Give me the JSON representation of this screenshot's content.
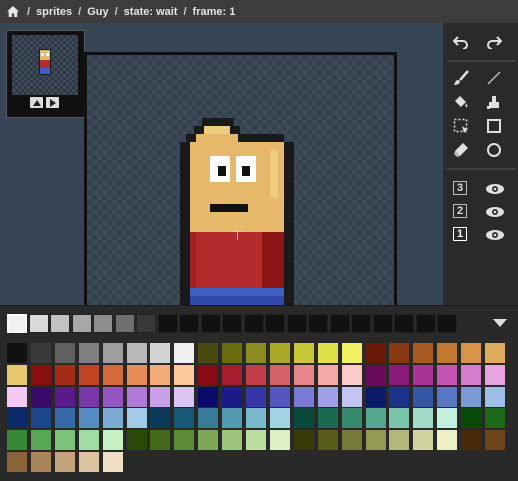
{
  "breadcrumb": {
    "home_icon": "home-icon",
    "items": [
      "sprites",
      "Guy",
      "state: wait",
      "frame: 1"
    ],
    "separator": "/"
  },
  "colors": {
    "topbar": "#3c3c3c",
    "canvas_bg": "#364657",
    "toolbar_bg": "#2a2a2a",
    "palette_bg": "#292929",
    "icon": "#e0e0e0"
  },
  "thumbnail": {
    "prev_icon": "caret-up-icon",
    "play_icon": "play-icon"
  },
  "tools": {
    "undo_icon": "undo-icon",
    "redo_icon": "redo-icon",
    "brush_icon": "brush-icon",
    "line_icon": "line-icon",
    "fill_icon": "paint-bucket-icon",
    "replace_icon": "color-replace-icon",
    "select_icon": "selection-icon",
    "rect_icon": "rectangle-icon",
    "eraser_icon": "eraser-icon",
    "circle_icon": "circle-icon"
  },
  "layers": [
    {
      "label": "3",
      "visible": true,
      "active": false
    },
    {
      "label": "2",
      "visible": true,
      "active": false
    },
    {
      "label": "1",
      "visible": true,
      "active": true
    }
  ],
  "sprite_colors": {
    "outline": "#1a1a1a",
    "skin": "#e6b86a",
    "skin_light": "#f0cc80",
    "eye_white": "#ffffff",
    "pupil": "#111111",
    "mouth": "#111111",
    "shirt": "#b52a2a",
    "shirt_dark": "#8f1616",
    "pants": "#3f5fc4"
  },
  "recent_colors": [
    "#f0f0f0",
    "#d9d9d9",
    "#c2c2c2",
    "#a8a8a8",
    "#8e8e8e",
    "#6f6f6f",
    "#3a3a3a",
    "#111111",
    "#111111",
    "#111111",
    "#111111",
    "#111111",
    "#111111",
    "#111111",
    "#111111",
    "#111111",
    "#111111",
    "#111111",
    "#111111",
    "#111111",
    "#111111"
  ],
  "palette_colors": [
    "#111111",
    "#3a3a3a",
    "#606060",
    "#7f7f7f",
    "#9e9e9e",
    "#b8b8b8",
    "#d4d4d4",
    "#efefef",
    "#4a4a0e",
    "#6c6c10",
    "#8b8b1e",
    "#aaaa28",
    "#c6c636",
    "#e0e048",
    "#f0f060",
    "#6b1a08",
    "#8a3812",
    "#a85a20",
    "#c2782e",
    "#d69444",
    "#e0ac5c",
    "#e8c86e",
    "#8a1010",
    "#a62a14",
    "#c24424",
    "#d66a3a",
    "#e88c56",
    "#f4ac78",
    "#fcc898",
    "#8a0a14",
    "#a81e30",
    "#c23c4a",
    "#d6606a",
    "#e8848a",
    "#f4a8aa",
    "#fccac8",
    "#6a0a5a",
    "#8a1a78",
    "#a83496",
    "#c256b2",
    "#d67ccc",
    "#e8a4e0",
    "#f4c8f0",
    "#3a0a6a",
    "#5a1a8a",
    "#7836a8",
    "#9656c2",
    "#b07ad6",
    "#c8a0e8",
    "#dcc4f4",
    "#0a0a6a",
    "#1a1a8a",
    "#3636a8",
    "#5656c2",
    "#7a7ad6",
    "#a0a0e8",
    "#c4c4f4",
    "#0a1a6a",
    "#1a348a",
    "#3656a8",
    "#5678c2",
    "#7a9ad6",
    "#a0bce8",
    "#0a2a6a",
    "#1a488a",
    "#366aa8",
    "#568cc2",
    "#7aacd6",
    "#a0cce8",
    "#0a3a5a",
    "#1a5878",
    "#367a96",
    "#569ab2",
    "#7ab8cc",
    "#a0d4e4",
    "#0a4a3a",
    "#1a6a52",
    "#368a6e",
    "#56a88c",
    "#7ac4aa",
    "#a0dcc6",
    "#c4f0e0",
    "#0a4a0a",
    "#1a6a1a",
    "#368a36",
    "#56a856",
    "#7ac47a",
    "#a0dca0",
    "#c4f0c4",
    "#2a4a0a",
    "#426a1a",
    "#5e8a36",
    "#7ca856",
    "#9cc47a",
    "#bcdca0",
    "#dcf0c4",
    "#3a3a0a",
    "#585a1a",
    "#767a36",
    "#949a56",
    "#b2b87a",
    "#cfd4a0",
    "#ecf0c4",
    "#4a2a0a",
    "#6a461a",
    "#8a6436",
    "#a88456",
    "#c4a47a",
    "#dcc4a0",
    "#f0e0c4"
  ]
}
